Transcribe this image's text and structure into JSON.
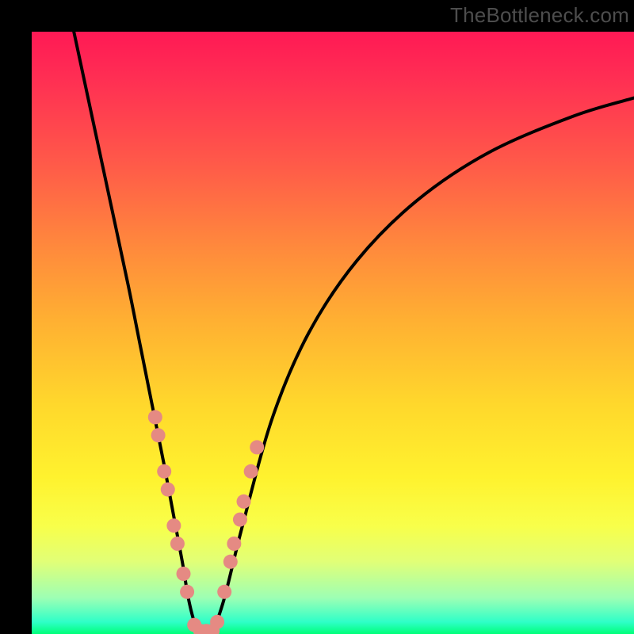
{
  "watermark": "TheBottleneck.com",
  "chart_data": {
    "type": "line",
    "title": "",
    "xlabel": "",
    "ylabel": "",
    "xlim": [
      0,
      100
    ],
    "ylim": [
      0,
      100
    ],
    "background": {
      "description": "vertical gradient red→orange→yellow→green representing bottleneck severity",
      "stops": [
        {
          "pos": 0.0,
          "color": "#ff1955"
        },
        {
          "pos": 0.22,
          "color": "#ff5a49"
        },
        {
          "pos": 0.48,
          "color": "#ffb032"
        },
        {
          "pos": 0.74,
          "color": "#fff22e"
        },
        {
          "pos": 0.94,
          "color": "#9dffb4"
        },
        {
          "pos": 1.0,
          "color": "#00ff7a"
        }
      ]
    },
    "series": [
      {
        "name": "left-curve",
        "color": "#000000",
        "x": [
          7,
          10,
          13,
          16,
          18,
          20,
          22,
          23.5,
          25,
          26,
          27,
          28
        ],
        "y": [
          100,
          86,
          72,
          58,
          48,
          38,
          28,
          20,
          12,
          6,
          2,
          0
        ]
      },
      {
        "name": "right-curve",
        "color": "#000000",
        "x": [
          30,
          32,
          35,
          40,
          46,
          54,
          64,
          76,
          90,
          100
        ],
        "y": [
          0,
          6,
          18,
          36,
          50,
          62,
          72,
          80,
          86,
          89
        ]
      }
    ],
    "markers": {
      "name": "highlighted-points",
      "color": "#e58a83",
      "radius_px": 9,
      "points": [
        {
          "x": 20.5,
          "y": 36
        },
        {
          "x": 21.0,
          "y": 33
        },
        {
          "x": 22.0,
          "y": 27
        },
        {
          "x": 22.6,
          "y": 24
        },
        {
          "x": 23.6,
          "y": 18
        },
        {
          "x": 24.2,
          "y": 15
        },
        {
          "x": 25.2,
          "y": 10
        },
        {
          "x": 25.8,
          "y": 7
        },
        {
          "x": 27.0,
          "y": 1.5
        },
        {
          "x": 28.0,
          "y": 0.5
        },
        {
          "x": 29.0,
          "y": 0.5
        },
        {
          "x": 30.0,
          "y": 0.5
        },
        {
          "x": 30.8,
          "y": 2
        },
        {
          "x": 32.0,
          "y": 7
        },
        {
          "x": 33.0,
          "y": 12
        },
        {
          "x": 33.6,
          "y": 15
        },
        {
          "x": 34.6,
          "y": 19
        },
        {
          "x": 35.2,
          "y": 22
        },
        {
          "x": 36.4,
          "y": 27
        },
        {
          "x": 37.4,
          "y": 31
        }
      ]
    }
  }
}
